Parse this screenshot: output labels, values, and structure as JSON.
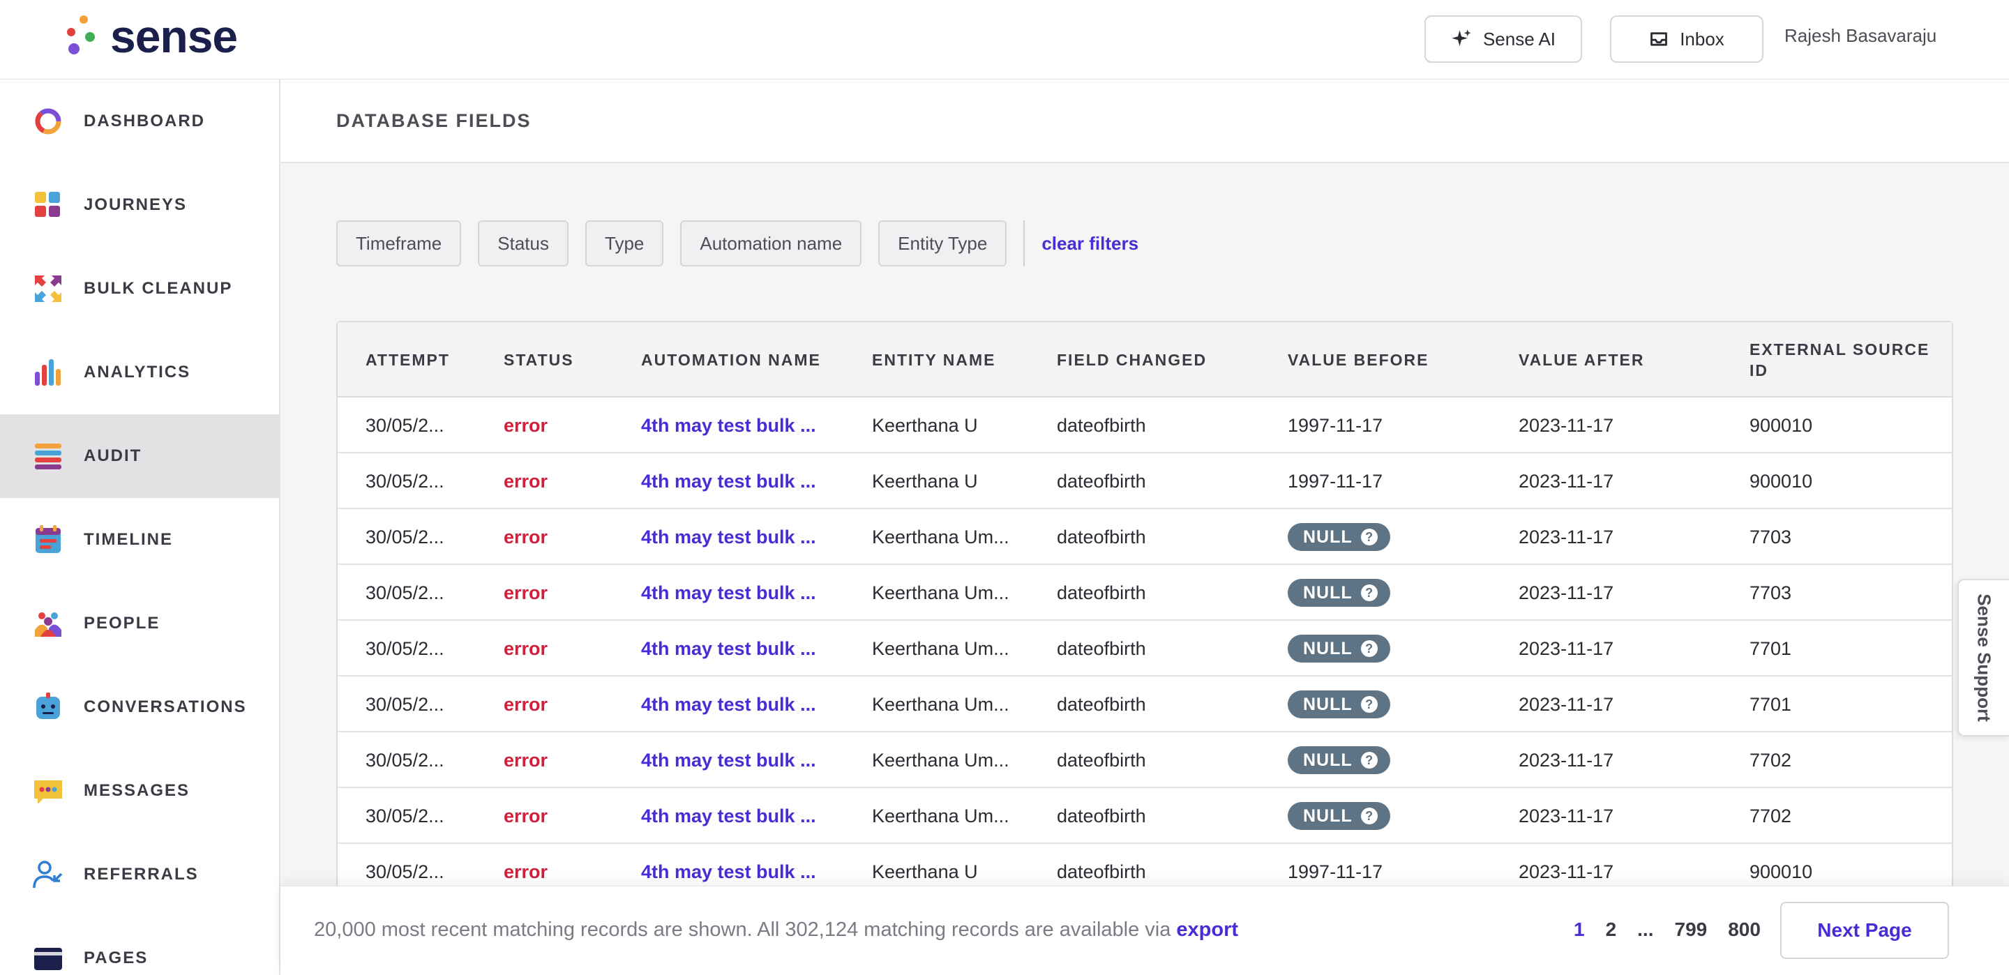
{
  "app": {
    "logo_text": "sense"
  },
  "header": {
    "sense_ai_label": "Sense AI",
    "inbox_label": "Inbox",
    "user_name": "Rajesh Basavaraju"
  },
  "sidebar": {
    "items": [
      {
        "label": "DASHBOARD",
        "icon": "dashboard-ring-icon"
      },
      {
        "label": "JOURNEYS",
        "icon": "journeys-grid-icon"
      },
      {
        "label": "BULK CLEANUP",
        "icon": "bulk-cleanup-arrows-icon"
      },
      {
        "label": "ANALYTICS",
        "icon": "analytics-bars-icon"
      },
      {
        "label": "AUDIT",
        "icon": "audit-list-icon",
        "active": true
      },
      {
        "label": "TIMELINE",
        "icon": "timeline-calendar-icon"
      },
      {
        "label": "PEOPLE",
        "icon": "people-group-icon"
      },
      {
        "label": "CONVERSATIONS",
        "icon": "conversations-bot-icon"
      },
      {
        "label": "MESSAGES",
        "icon": "messages-bubble-icon"
      },
      {
        "label": "REFERRALS",
        "icon": "referrals-user-icon"
      },
      {
        "label": "PAGES",
        "icon": "pages-card-icon"
      }
    ]
  },
  "main": {
    "page_title": "DATABASE FIELDS",
    "filters": [
      "Timeframe",
      "Status",
      "Type",
      "Automation name",
      "Entity Type"
    ],
    "clear_filters": "clear filters"
  },
  "table": {
    "headers": [
      "ATTEMPT",
      "STATUS",
      "AUTOMATION NAME",
      "ENTITY NAME",
      "FIELD CHANGED",
      "VALUE BEFORE",
      "VALUE AFTER",
      "EXTERNAL SOURCE ID"
    ],
    "null_label": "NULL",
    "rows": [
      {
        "attempt": "30/05/2...",
        "status": "error",
        "automation": "4th may test bulk ...",
        "entity": "Keerthana U",
        "field": "dateofbirth",
        "before": "1997-11-17",
        "after": "2023-11-17",
        "source_id": "900010"
      },
      {
        "attempt": "30/05/2...",
        "status": "error",
        "automation": "4th may test bulk ...",
        "entity": "Keerthana U",
        "field": "dateofbirth",
        "before": "1997-11-17",
        "after": "2023-11-17",
        "source_id": "900010"
      },
      {
        "attempt": "30/05/2...",
        "status": "error",
        "automation": "4th may test bulk ...",
        "entity": "Keerthana Um...",
        "field": "dateofbirth",
        "before": null,
        "after": "2023-11-17",
        "source_id": "7703"
      },
      {
        "attempt": "30/05/2...",
        "status": "error",
        "automation": "4th may test bulk ...",
        "entity": "Keerthana Um...",
        "field": "dateofbirth",
        "before": null,
        "after": "2023-11-17",
        "source_id": "7703"
      },
      {
        "attempt": "30/05/2...",
        "status": "error",
        "automation": "4th may test bulk ...",
        "entity": "Keerthana Um...",
        "field": "dateofbirth",
        "before": null,
        "after": "2023-11-17",
        "source_id": "7701"
      },
      {
        "attempt": "30/05/2...",
        "status": "error",
        "automation": "4th may test bulk ...",
        "entity": "Keerthana Um...",
        "field": "dateofbirth",
        "before": null,
        "after": "2023-11-17",
        "source_id": "7701"
      },
      {
        "attempt": "30/05/2...",
        "status": "error",
        "automation": "4th may test bulk ...",
        "entity": "Keerthana Um...",
        "field": "dateofbirth",
        "before": null,
        "after": "2023-11-17",
        "source_id": "7702"
      },
      {
        "attempt": "30/05/2...",
        "status": "error",
        "automation": "4th may test bulk ...",
        "entity": "Keerthana Um...",
        "field": "dateofbirth",
        "before": null,
        "after": "2023-11-17",
        "source_id": "7702"
      },
      {
        "attempt": "30/05/2...",
        "status": "error",
        "automation": "4th may test bulk ...",
        "entity": "Keerthana U",
        "field": "dateofbirth",
        "before": "1997-11-17",
        "after": "2023-11-17",
        "source_id": "900010"
      }
    ]
  },
  "footer": {
    "records_text": "20,000 most recent matching records are shown. All 302,124 matching records are available via ",
    "export_link": "export",
    "pages": [
      "1",
      "2",
      "...",
      "799",
      "800"
    ],
    "current_page": "1",
    "next_label": "Next Page"
  },
  "support": {
    "label": "Sense Support"
  },
  "colors": {
    "accent": "#4a2bd6",
    "error": "#d0203a",
    "null_badge": "#5e7383",
    "active_nav": "#e2e2e4"
  }
}
